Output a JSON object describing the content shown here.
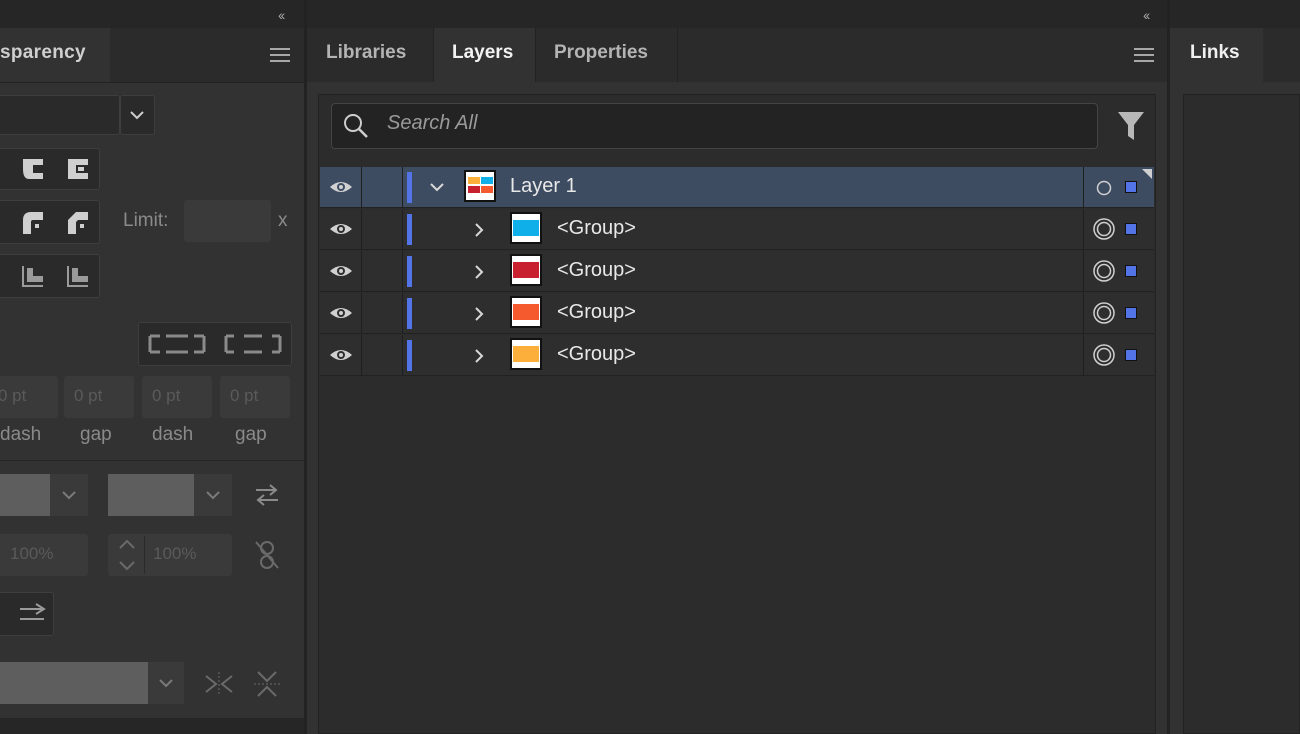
{
  "left_panel": {
    "tab_label": "sparency",
    "limit_label": "Limit:",
    "limit_unit": "x",
    "dash_gap": [
      {
        "value": "0 pt",
        "label": "dash"
      },
      {
        "value": "0 pt",
        "label": "gap"
      },
      {
        "value": "0 pt",
        "label": "dash"
      },
      {
        "value": "0 pt",
        "label": "gap"
      }
    ],
    "scale_start": "100%",
    "scale_end": "100%"
  },
  "tabs": [
    {
      "label": "Libraries",
      "active": false
    },
    {
      "label": "Layers",
      "active": true
    },
    {
      "label": "Properties",
      "active": false
    }
  ],
  "search": {
    "placeholder": "Search All"
  },
  "layers": [
    {
      "name": "Layer 1",
      "type": "layer",
      "expanded": true,
      "selected": true
    },
    {
      "name": "<Group>",
      "type": "group",
      "swatch": "#0fb0ea"
    },
    {
      "name": "<Group>",
      "type": "group",
      "swatch": "#c8202f"
    },
    {
      "name": "<Group>",
      "type": "group",
      "swatch": "#f45a2e"
    },
    {
      "name": "<Group>",
      "type": "group",
      "swatch": "#fcaf3b"
    }
  ],
  "layer_color": "#5374e6",
  "right_panel": {
    "tab_label": "Links"
  }
}
